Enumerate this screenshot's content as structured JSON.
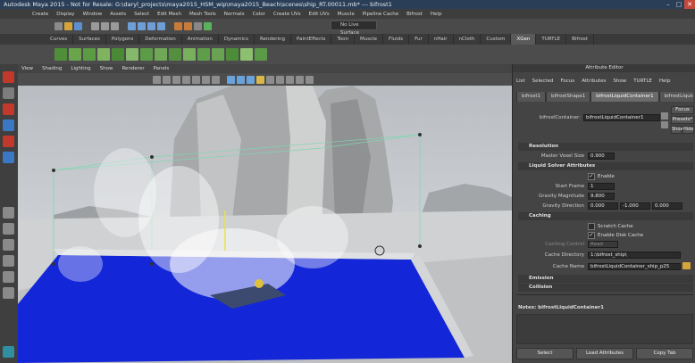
{
  "window": {
    "title": "Autodesk Maya 2015 - Not for Resale: G:\\daryl_projects\\maya2015_HSM_wip\\maya2015_Beach\\scenes\\ship_RT.00011.mb*  ---  bifrost1",
    "controls": [
      "–",
      "□",
      "✕"
    ]
  },
  "menubar": {
    "items": [
      "Create",
      "Display",
      "Window",
      "Assets",
      "Select",
      "Edit Mesh",
      "Mesh Tools",
      "Normals",
      "Color",
      "Create UVs",
      "Edit UVs",
      "Muscle",
      "Pipeline Cache",
      "Bifrost",
      "Help"
    ]
  },
  "status_toolbar": {
    "live_surface": "No Live Surface"
  },
  "shelf": {
    "tabs": [
      "Curves",
      "Surfaces",
      "Polygons",
      "Deformation",
      "Animation",
      "Dynamics",
      "Rendering",
      "PaintEffects",
      "Toon",
      "Muscle",
      "Fluids",
      "Fur",
      "nHair",
      "nCloth",
      "Custom",
      "XGen",
      "TURTLE",
      "Bifrost"
    ],
    "active_tab": "XGen"
  },
  "viewport": {
    "menus": [
      "View",
      "Shading",
      "Lighting",
      "Show",
      "Renderer",
      "Panels"
    ]
  },
  "attribute_editor": {
    "header": "Attribute Editor",
    "menus": [
      "List",
      "Selected",
      "Focus",
      "Attributes",
      "Show",
      "TURTLE",
      "Help"
    ],
    "node_tabs": [
      "bifrost1",
      "bifrostShape1",
      "bifrostLiquidContainer1",
      "bifrostLiquidMe"
    ],
    "active_node_tab": "bifrostLiquidContainer1",
    "node_label": "bifrostContainer:",
    "node_value": "bifrostLiquidContainer1",
    "side_buttons": [
      "Focus",
      "Presets*",
      "Show",
      "Hide"
    ],
    "sections": {
      "resolution": {
        "title": "Resolution",
        "master_voxel_size_label": "Master Voxel Size",
        "master_voxel_size": "0.900"
      },
      "solver": {
        "title": "Liquid Solver Attributes",
        "enable_label": "Enable",
        "start_frame_label": "Start Frame",
        "start_frame": "1",
        "gravity_magnitude_label": "Gravity Magnitude",
        "gravity_magnitude": "9.800",
        "gravity_direction_label": "Gravity Direction",
        "gravity_direction": [
          "0.000",
          "-1.000",
          "0.000"
        ]
      },
      "caching": {
        "title": "Caching",
        "scratch_cache_label": "Scratch Cache",
        "enable_disk_cache_label": "Enable Disk Cache",
        "caching_control_label": "Caching Control",
        "caching_control_value": "Read",
        "cache_directory_label": "Cache Directory",
        "cache_directory": "1:\\bifrost_ship\\",
        "cache_name_label": "Cache Name",
        "cache_name": "bifrostLiquidContainer_ship_p25"
      },
      "emission": {
        "title": "Emission"
      },
      "collision": {
        "title": "Collision"
      }
    },
    "notes_label": "Notes:  bifrostLiquidContainer1",
    "bottom_buttons": [
      "Select",
      "Load Attributes",
      "Copy Tab"
    ]
  },
  "colors": {
    "title_bg": "#2a3f57",
    "close": "#c64a3c",
    "water": "#1427d8",
    "accent": "#5b8fd1"
  }
}
